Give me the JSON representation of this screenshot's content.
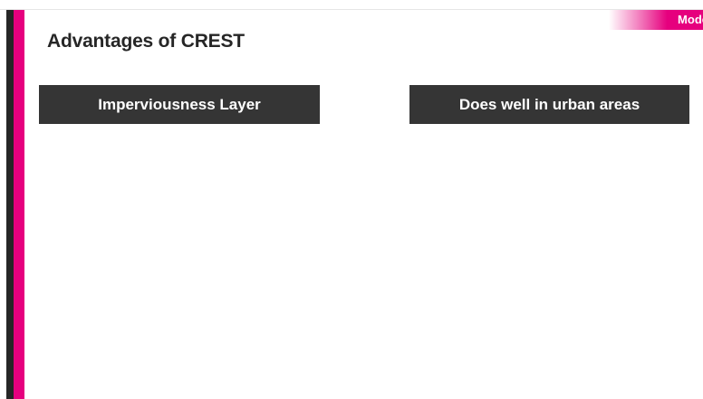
{
  "slide": {
    "title": "Advantages of CREST",
    "corner_tab": "Mode",
    "boxes": [
      {
        "label": "Imperviousness Layer"
      },
      {
        "label": "Does well in urban areas"
      }
    ]
  },
  "colors": {
    "accent": "#e6007e",
    "dark": "#262626",
    "box_bg": "#353535",
    "background": "#ffffff"
  }
}
